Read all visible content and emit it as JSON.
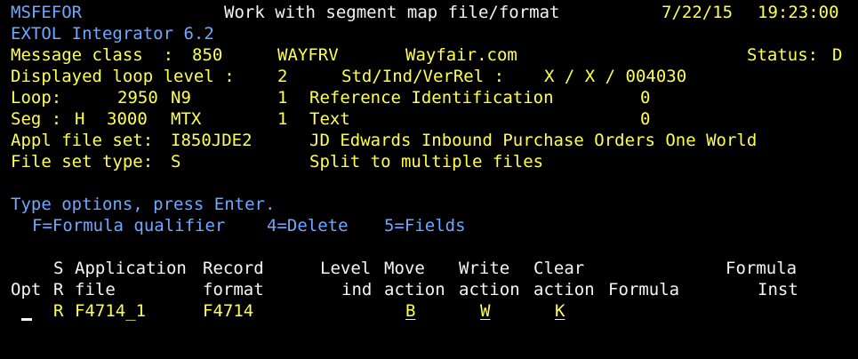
{
  "header": {
    "program": "MSFEFOR",
    "title": "Work with segment map file/format",
    "date": "7/22/15",
    "time": "19:23:00",
    "product": "EXTOL Integrator 6.2"
  },
  "info": {
    "message_class_label": "Message class  :",
    "message_class_value": "850",
    "partner_id": "WAYFRV",
    "partner_name": "Wayfair.com",
    "status_label": "Status:",
    "status_value": "D",
    "loop_level_label": "Displayed loop level :",
    "loop_level_value": "2",
    "std_label": "Std/Ind/VerRel :",
    "std_value": "X / X / 004030",
    "loop_label": "Loop:",
    "loop_number": "2950",
    "loop_id": "N9",
    "loop_count": "1",
    "loop_desc": "Reference Identification",
    "loop_extra": "0",
    "seg_label": "Seg :",
    "seg_area": "H",
    "seg_number": "3000",
    "seg_id": "MTX",
    "seg_count": "1",
    "seg_desc": "Text",
    "seg_extra": "0",
    "appl_label": "Appl file set:",
    "appl_value": "I850JDE2",
    "appl_desc": "JD Edwards Inbound Purchase Orders One World",
    "fst_label": "File set type:",
    "fst_value": "S",
    "fst_desc": "Split to multiple files"
  },
  "instructions": {
    "line1": "Type options, press Enter.",
    "opt_f": "F=Formula qualifier",
    "opt_4": "4=Delete",
    "opt_5": "5=Fields"
  },
  "columns": {
    "row1": {
      "s": "S",
      "application": "Application",
      "record": "Record",
      "level": "Level",
      "move": "Move",
      "write": "Write",
      "clear": "Clear",
      "formula_inst": "Formula"
    },
    "row2": {
      "opt": "Opt",
      "r": "R",
      "file": "file",
      "format": "format",
      "ind": "ind",
      "move": "action",
      "write": "action",
      "clear": "action",
      "formula": "Formula",
      "inst": "Inst"
    }
  },
  "rows": [
    {
      "opt": "",
      "sr": "R",
      "file": "F4714_1",
      "format": "F4714",
      "level_ind": "",
      "move": "B",
      "write": "W",
      "clear": "K",
      "formula": "",
      "inst": ""
    }
  ]
}
